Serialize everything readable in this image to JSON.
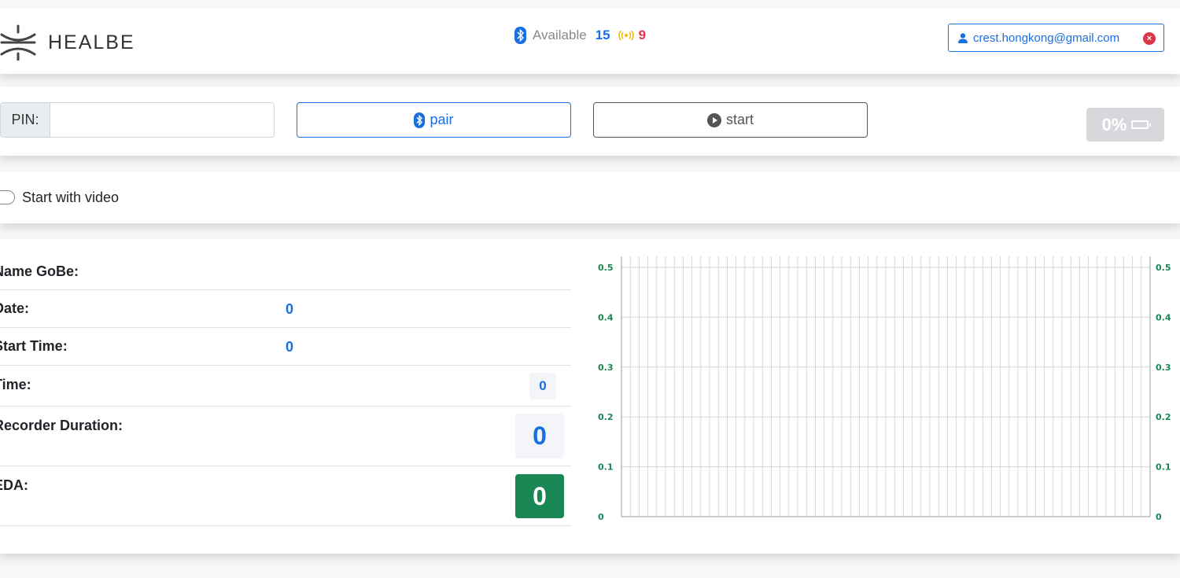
{
  "header": {
    "brand": "HEALBE",
    "available_label": "Available",
    "available_count": "15",
    "signal_count": "9",
    "user_email": "crest.hongkong@gmail.com"
  },
  "controls": {
    "pin_label": "PIN:",
    "pin_value": "",
    "pair_label": "pair",
    "start_label": "start",
    "battery": "0%"
  },
  "video": {
    "toggle_label": "Start with video",
    "enabled": false
  },
  "info": {
    "name_label": "Name GoBe:",
    "date_label": "Date:",
    "date_value": "0",
    "start_time_label": "Start Time:",
    "start_time_value": "0",
    "time_label": "Time:",
    "time_value": "0",
    "duration_label": "Recorder Duration:",
    "duration_value": "0",
    "eda_label": "EDA:",
    "eda_value": "0"
  },
  "colors": {
    "accent": "#1a6fe0",
    "danger": "#dc3545",
    "warning": "#f5b800",
    "success": "#198754"
  },
  "chart_data": {
    "type": "line",
    "series": [],
    "ylim": [
      0,
      0.5
    ],
    "y_ticks": [
      "0.5",
      "0.4",
      "0.3",
      "0.2",
      "0.1",
      "0"
    ],
    "y_axes": [
      "left",
      "right"
    ],
    "grid": true,
    "vertical_gridlines": 60
  }
}
